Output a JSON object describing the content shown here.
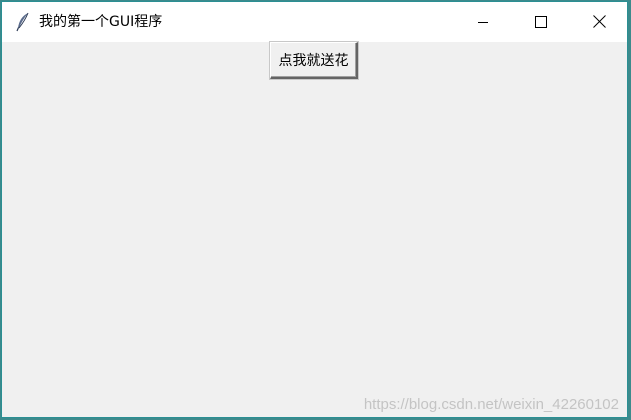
{
  "window": {
    "title": "我的第一个GUI程序"
  },
  "title_controls": {
    "minimize_icon": "minimize-icon",
    "maximize_icon": "maximize-icon",
    "close_icon": "close-icon"
  },
  "main": {
    "button_label": "点我就送花"
  },
  "watermark": {
    "text": "https://blog.csdn.net/weixin_42260102"
  },
  "colors": {
    "window_background": "#f0f0f0",
    "titlebar_background": "#ffffff",
    "window_border": "#2b8f93"
  }
}
